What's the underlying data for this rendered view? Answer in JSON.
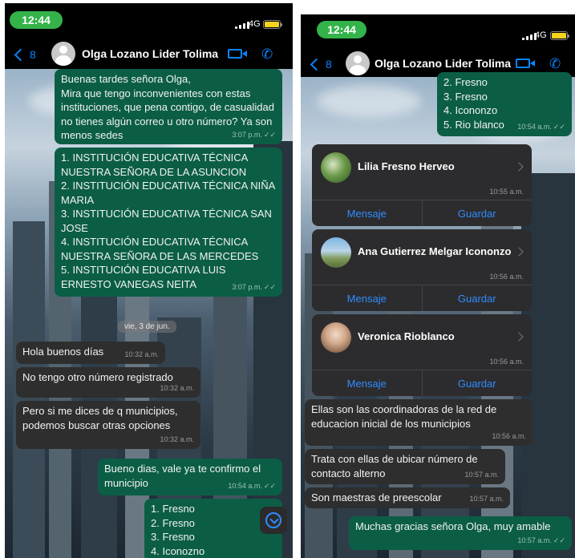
{
  "status": {
    "time": "12:44",
    "network": "4G"
  },
  "header": {
    "back_count": "8",
    "contact_name": "Olga Lozano Lider Tolima"
  },
  "left": {
    "messages": [
      {
        "dir": "out",
        "text": "Buenas tardes señora Olga,\nMira que tengo inconvenientes con estas instituciones, que pena contigo, de casualidad no tienes algún correo u otro número? Ya son menos sedes",
        "time": "3:07 p.m."
      },
      {
        "dir": "out",
        "text": "1. INSTITUCIÓN EDUCATIVA TÉCNICA NUESTRA SEÑORA DE LA ASUNCION\n2. INSTITUCIÓN EDUCATIVA TÉCNICA NIÑA MARIA\n3. INSTITUCIÓN EDUCATIVA TÉCNICA SAN JOSE\n4. INSTITUCIÓN EDUCATIVA TÉCNICA NUESTRA SEÑORA DE LAS MERCEDES\n5. INSTITUCIÓN EDUCATIVA LUIS ERNESTO VANEGAS NEITA",
        "time": "3:07 p.m."
      },
      {
        "dir": "in",
        "text": "Hola buenos días",
        "time": "10:32 a.m."
      },
      {
        "dir": "in",
        "text": "No tengo otro número registrado",
        "time": "10:32 a.m."
      },
      {
        "dir": "in",
        "text": "Pero si me dices de q municipios, podemos buscar otras opciones",
        "time": "10:32 a.m."
      },
      {
        "dir": "out",
        "text": "Bueno dias, vale ya te confirmo el municipio",
        "time": "10:54 a.m."
      },
      {
        "dir": "out",
        "text": "1. Fresno\n2. Fresno\n3. Fresno\n4. Iconozno",
        "time": ""
      }
    ],
    "date_chip": "vie, 3 de jun."
  },
  "right": {
    "top_message": {
      "text": "2. Fresno\n3. Fresno\n4. Icononzo\n5. Rio blanco",
      "time": "10:54 a.m."
    },
    "contacts": [
      {
        "name": "Lilia Fresno Herveo",
        "time": "10:55 a.m.",
        "btn_message": "Mensaje",
        "btn_save": "Guardar"
      },
      {
        "name": "Ana Gutierrez Melgar Icononzo",
        "time": "10:56 a.m.",
        "btn_message": "Mensaje",
        "btn_save": "Guardar"
      },
      {
        "name": "Veronica Rioblanco",
        "time": "10:56 a.m.",
        "btn_message": "Mensaje",
        "btn_save": "Guardar"
      }
    ],
    "messages": [
      {
        "dir": "in",
        "text": "Ellas son las coordinadoras de la red de educacion inicial de los municipios",
        "time": "10:56 a.m."
      },
      {
        "dir": "in",
        "text": "Trata con ellas de ubicar número de contacto alterno",
        "time": "10:57 a.m."
      },
      {
        "dir": "in",
        "text": "Son maestras de preescolar",
        "time": "10:57 a.m."
      },
      {
        "dir": "out",
        "text": "Muchas gracias señora Olga, muy amable",
        "time": "10:57 a.m."
      }
    ]
  },
  "colors": {
    "outgoing": "#0b5e45",
    "incoming": "#2e2e2e",
    "accent": "#0a84ff",
    "time_pill": "#33b34a"
  },
  "icons": [
    "back-chevron-icon",
    "video-call-icon",
    "voice-call-icon",
    "scroll-down-icon",
    "signal-icon",
    "battery-icon",
    "read-ticks-icon",
    "chevron-right-icon"
  ]
}
